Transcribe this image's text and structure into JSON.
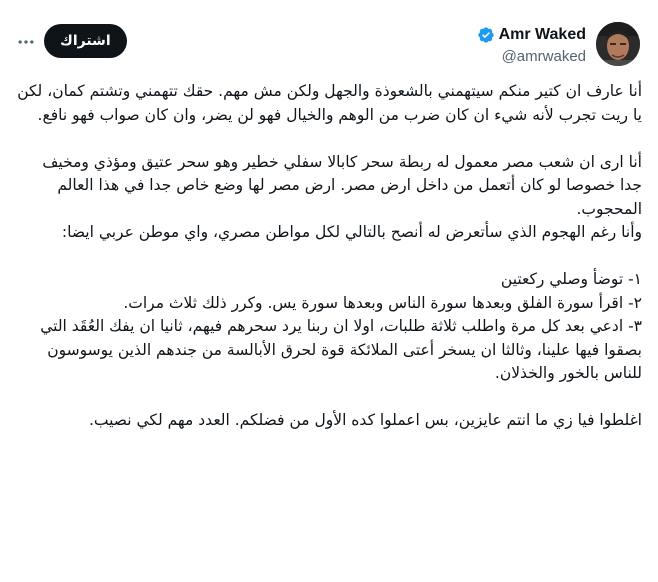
{
  "header": {
    "display_name": "Amr Waked",
    "handle": "@amrwaked",
    "follow_label": "اشتراك"
  },
  "icons": {
    "verified": "verified-badge-icon",
    "more": "more-options-icon"
  },
  "colors": {
    "verified_blue": "#1d9bf0",
    "follow_button_bg": "#0f1419",
    "handle_gray": "#536471"
  },
  "tweet": {
    "paragraphs": [
      "أنا عارف ان كتير منكم سيتهمني بالشعوذة والجهل ولكن مش مهم. حقك تتهمني وتشتم كمان، لكن يا ريت تجرب لأنه شيء ان كان ضرب من الوهم والخيال فهو لن يضر، وان كان صواب فهو نافع.",
      "أنا ارى ان شعب مصر معمول له ربطة سحر كابالا سفلي خطير وهو سحر عتيق ومؤذي ومخيف جدا خصوصا لو كان أتعمل من داخل ارض مصر. ارض مصر لها وضع خاص جدا في هذا العالم المحجوب.",
      "وأنا رغم الهجوم الذي سأتعرض له أنصح بالتالي لكل مواطن مصري، واي موطن عربي ايضا:",
      "١- توضأ وصلي ركعتين",
      "٢- اقرأ سورة الفلق وبعدها سورة الناس وبعدها سورة يس. وكرر ذلك ثلاث مرات.",
      "٣- ادعي بعد كل مرة واطلب ثلاثة طلبات، اولا ان ربنا يرد سحرهم فيهم، ثانيا ان يفك العُقَد التي بصقوا فيها علينا، وثالثا ان يسخر أعتى الملائكة قوة لحرق الأبالسة من جندهم الذين يوسوسون للناس بالخور والخذلان.",
      "اغلطوا فيا زي ما انتم عايزين، بس اعملوا كده الأول من فضلكم. العدد مهم لكي نصيب."
    ]
  }
}
